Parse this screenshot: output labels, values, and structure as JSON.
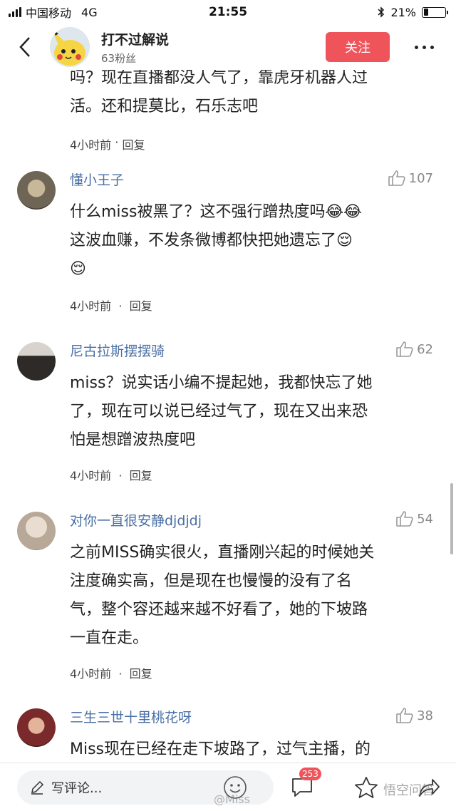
{
  "status_bar": {
    "carrier": "中国移动",
    "network": "4G",
    "time": "21:55",
    "bluetooth_icon": "bluetooth-icon",
    "battery_text": "21%",
    "battery_level": 0.21
  },
  "header": {
    "back_icon": "chevron-left-icon",
    "author_name": "打不过解说",
    "fans": "63粉丝",
    "follow_label": "关注",
    "more_icon": "more-dots-icon",
    "follow_color": "#f0545b"
  },
  "top_comment": {
    "line1": "吗？现在直播都没人气了，靠虎牙机器人过",
    "line2": "活。还和提莫比，石乐志吧",
    "time": "4小时前",
    "reply": "回复"
  },
  "comments": [
    {
      "name": "懂小王子",
      "likes": "107",
      "lines": [
        "什么miss被黑了？这不强行蹭热度吗😂😂",
        "这波血赚，不发条微博都快把她遗忘了😌",
        "😌"
      ],
      "time": "4小时前",
      "reply": "回复"
    },
    {
      "name": "尼古拉斯摆摆骑",
      "likes": "62",
      "lines": [
        "miss？说实话小编不提起她，我都快忘了她",
        "了，现在可以说已经过气了，现在又出来恐",
        "怕是想蹭波热度吧"
      ],
      "time": "4小时前",
      "reply": "回复"
    },
    {
      "name": "对你一直很安静djdjdj",
      "likes": "54",
      "lines": [
        "之前MISS确实很火，直播刚兴起的时候她关",
        "注度确实高，但是现在也慢慢的没有了名",
        "气，整个容还越来越不好看了，她的下坡路",
        "一直在走。"
      ],
      "time": "4小时前",
      "reply": "回复"
    },
    {
      "name": "三生三世十里桃花呀",
      "likes": "38",
      "lines": [
        "Miss现在已经在走下坡路了，过气主播，的"
      ],
      "time": "",
      "reply": ""
    }
  ],
  "bottom_bar": {
    "input_placeholder": "写评论...",
    "pen_icon": "pen-icon",
    "emoji_icon": "emoji-icon",
    "comment_icon": "comment-bubble-icon",
    "comment_count": "253",
    "star_icon": "star-icon",
    "share_icon": "share-icon"
  },
  "watermarks": {
    "weibo": "@Miss",
    "brand": "悟空问答"
  }
}
